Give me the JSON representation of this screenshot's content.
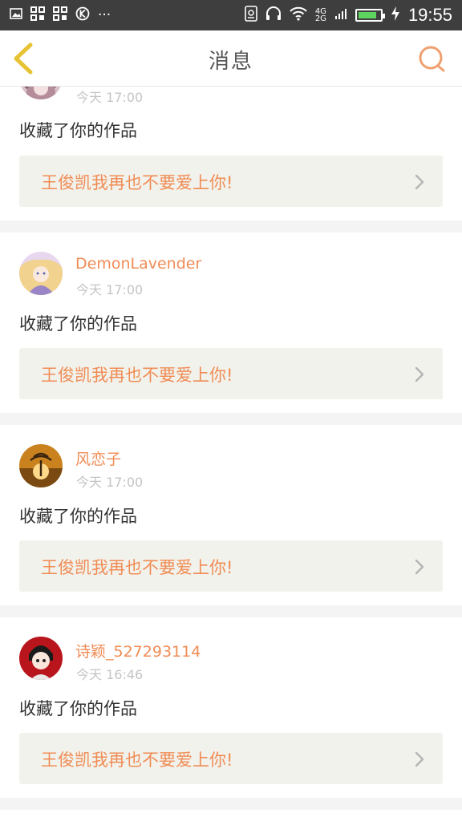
{
  "status_bar": {
    "left_icons": [
      "image-icon",
      "qr-icon",
      "qr-icon",
      "k-icon"
    ],
    "ellipsis": "···",
    "network": [
      "4G",
      "2G"
    ],
    "battery_level": 0.85,
    "time": "19:55"
  },
  "header": {
    "title": "消息",
    "back_icon": "chevron-left-icon",
    "search_icon": "search-icon"
  },
  "notifications": [
    {
      "username": "",
      "time": "今天  17:00",
      "action": "收藏了你的作品",
      "work_title": "王俊凯我再也不要爱上你!"
    },
    {
      "username": "DemonLavender",
      "time": "今天  17:00",
      "action": "收藏了你的作品",
      "work_title": "王俊凯我再也不要爱上你!"
    },
    {
      "username": "风恋子",
      "time": "今天  17:00",
      "action": "收藏了你的作品",
      "work_title": "王俊凯我再也不要爱上你!"
    },
    {
      "username": "诗颖_527293114",
      "time": "今天  16:46",
      "action": "收藏了你的作品",
      "work_title": "王俊凯我再也不要爱上你!"
    }
  ],
  "colors": {
    "accent": "#f08c55",
    "back_icon": "#e8c235",
    "status_bar": "#3e3e3e"
  }
}
